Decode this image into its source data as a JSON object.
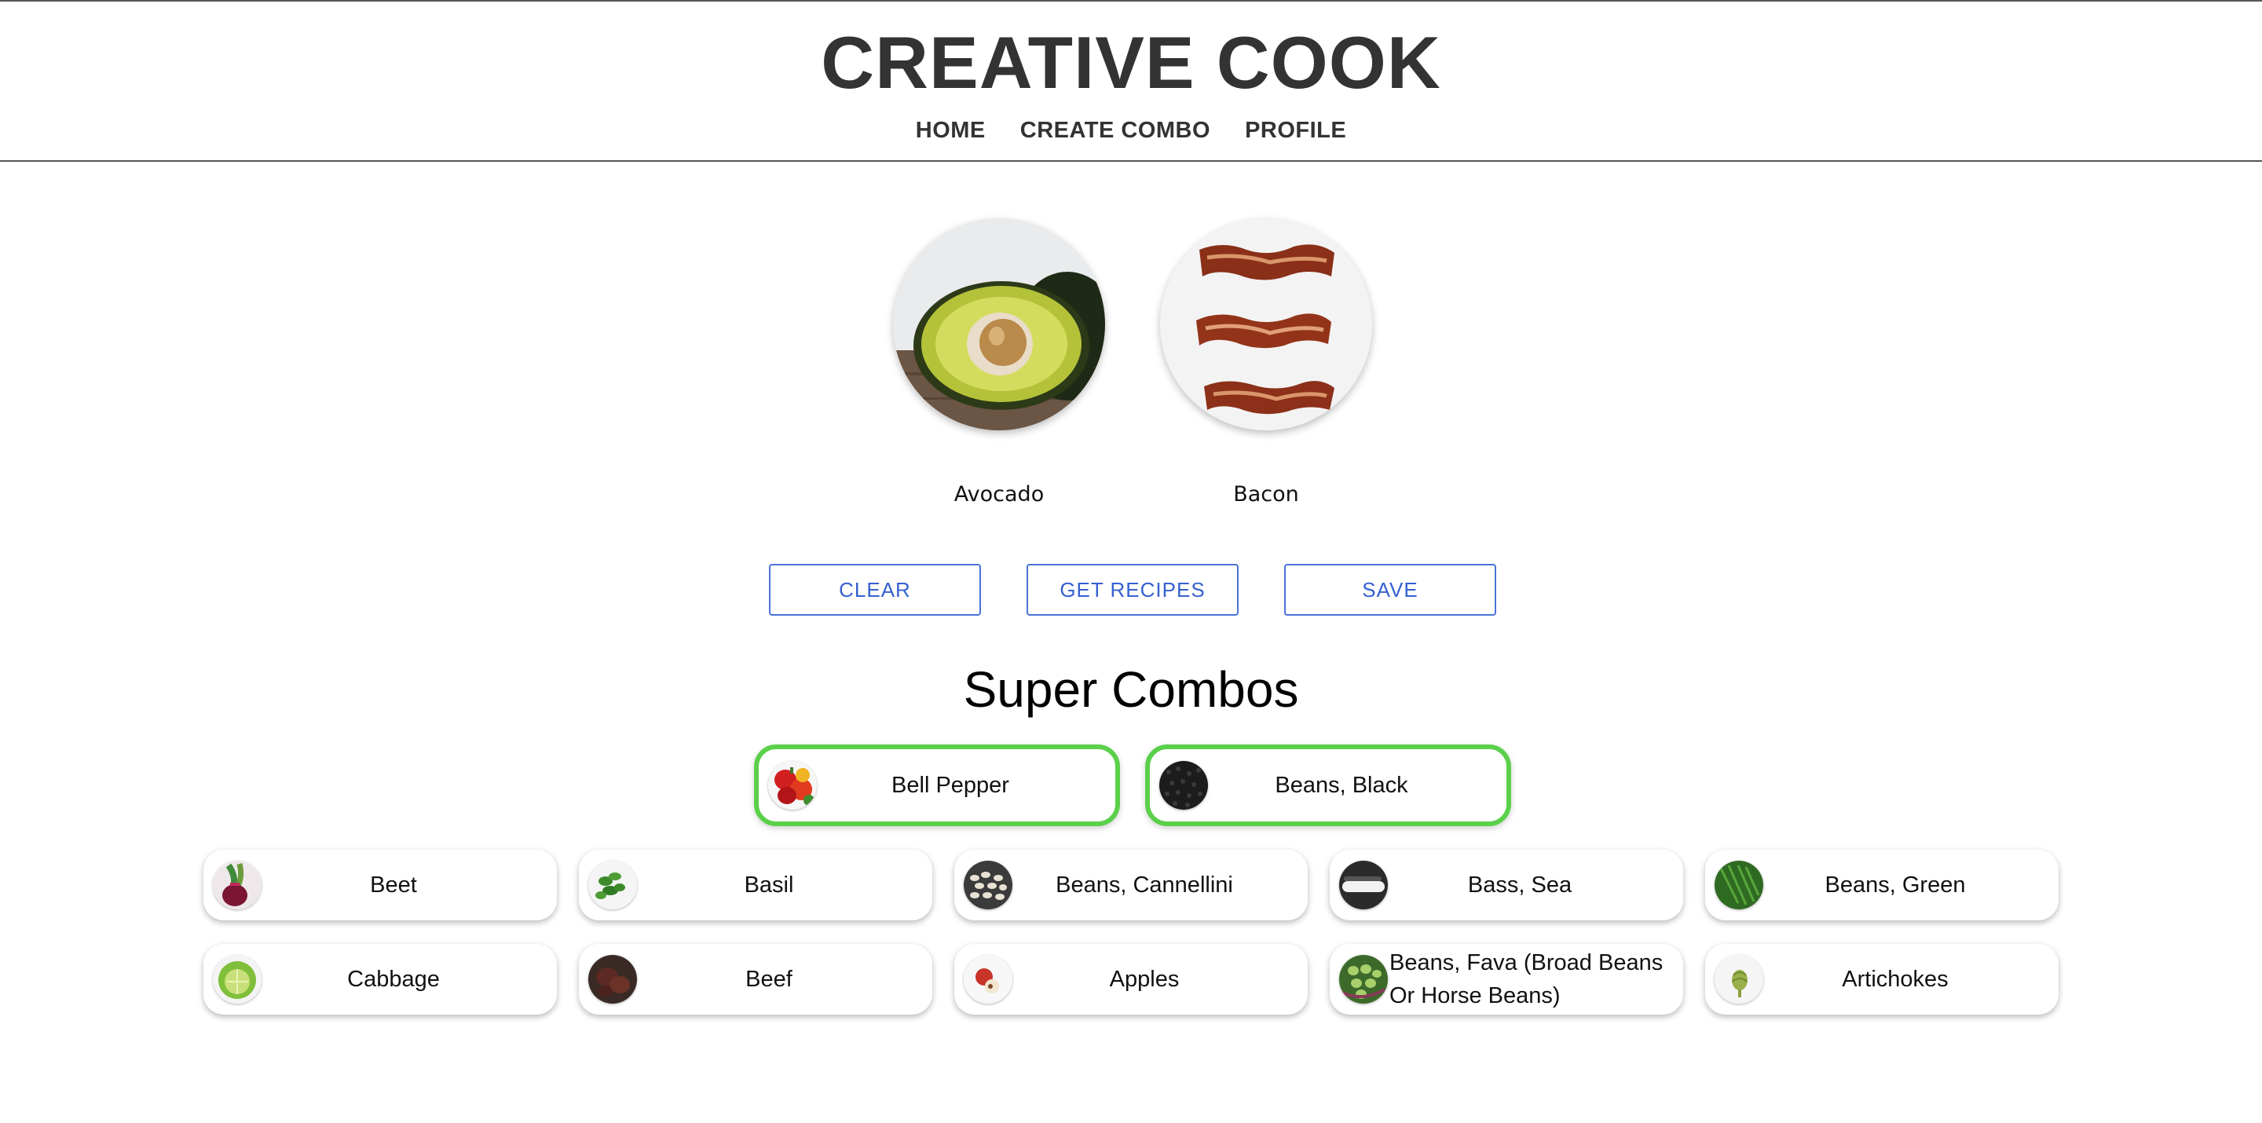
{
  "header": {
    "title": "CREATIVE COOK",
    "nav": [
      "HOME",
      "CREATE COMBO",
      "PROFILE"
    ]
  },
  "selected_ingredients": [
    {
      "label": "Avocado",
      "icon": "avocado-image"
    },
    {
      "label": "Bacon",
      "icon": "bacon-image"
    }
  ],
  "actions": {
    "clear": "CLEAR",
    "get_recipes": "GET RECIPES",
    "save": "SAVE"
  },
  "super_combos": {
    "title": "Super Combos",
    "highlight_color": "#5bd04a",
    "featured": [
      {
        "label": "Bell Pepper",
        "icon": "bell-pepper-thumb"
      },
      {
        "label": "Beans, Black",
        "icon": "black-beans-thumb"
      }
    ],
    "items": [
      {
        "label": "Beet",
        "icon": "beet-thumb"
      },
      {
        "label": "Basil",
        "icon": "basil-thumb"
      },
      {
        "label": "Beans, Cannellini",
        "icon": "cannellini-thumb"
      },
      {
        "label": "Bass, Sea",
        "icon": "sea-bass-thumb"
      },
      {
        "label": "Beans, Green",
        "icon": "green-beans-thumb"
      },
      {
        "label": "Cabbage",
        "icon": "cabbage-thumb"
      },
      {
        "label": "Beef",
        "icon": "beef-thumb"
      },
      {
        "label": "Apples",
        "icon": "apples-thumb"
      },
      {
        "label": "Beans, Fava (Broad Beans Or Horse Beans)",
        "icon": "fava-beans-thumb"
      },
      {
        "label": "Artichokes",
        "icon": "artichokes-thumb"
      }
    ]
  },
  "colors": {
    "button_border": "#4a73d9",
    "button_text": "#3560d0",
    "header_text": "#333333"
  }
}
